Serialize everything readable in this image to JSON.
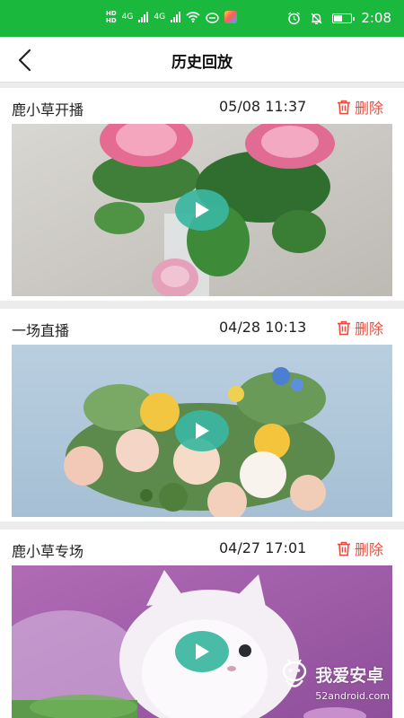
{
  "status_bar": {
    "network_top": "HD",
    "network_bottom": "HD",
    "signal_1_label": "4G",
    "signal_2_label": "4G",
    "time": "2:08"
  },
  "header": {
    "title": "历史回放",
    "back_icon": "chevron-left-icon"
  },
  "records": [
    {
      "title": "鹿小草开播",
      "time": "05/08 11:37",
      "delete_label": "删除"
    },
    {
      "title": "一场直播",
      "time": "04/28 10:13",
      "delete_label": "删除"
    },
    {
      "title": "鹿小草专场",
      "time": "04/27 17:01",
      "delete_label": "删除"
    }
  ],
  "watermark": {
    "name": "我爱安卓",
    "url": "52android.com"
  },
  "colors": {
    "status_bar": "#1ab93d",
    "delete": "#f04a3c",
    "play_button": "#39b6a1",
    "background": "#ececec"
  }
}
